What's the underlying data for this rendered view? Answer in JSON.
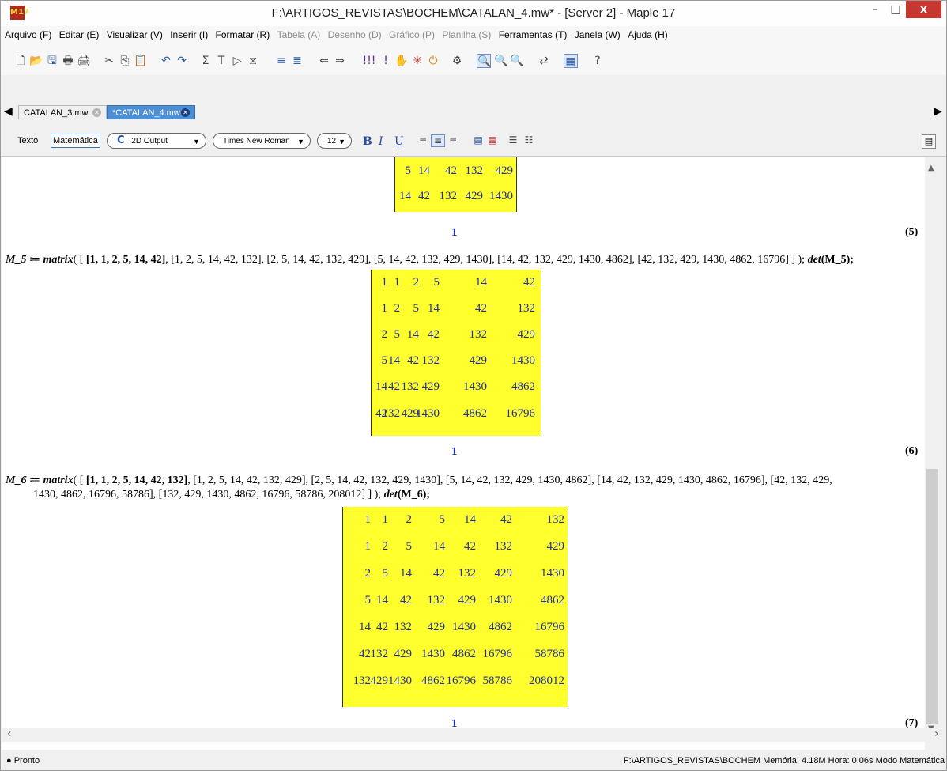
{
  "window": {
    "title": "F:\\ARTIGOS_REVISTAS\\BOCHEM\\CATALAN_4.mw* - [Server 2] - Maple 17",
    "icon_label": "M17",
    "min_glyph": "–",
    "max_glyph": "□",
    "close_glyph": "x"
  },
  "menu": {
    "items": [
      {
        "label": "Arquivo (F)",
        "enabled": true
      },
      {
        "label": "Editar (E)",
        "enabled": true
      },
      {
        "label": "Visualizar (V)",
        "enabled": true
      },
      {
        "label": "Inserir (I)",
        "enabled": true
      },
      {
        "label": "Formatar (R)",
        "enabled": true
      },
      {
        "label": "Tabela (A)",
        "enabled": false
      },
      {
        "label": "Desenho (D)",
        "enabled": false
      },
      {
        "label": "Gráfico (P)",
        "enabled": false
      },
      {
        "label": "Planilha (S)",
        "enabled": false
      },
      {
        "label": "Ferramentas (T)",
        "enabled": true
      },
      {
        "label": "Janela (W)",
        "enabled": true
      },
      {
        "label": "Ajuda (H)",
        "enabled": true
      }
    ]
  },
  "toolbar": {
    "icons": [
      "new-document-icon",
      "open-icon",
      "save-icon",
      "print-icon",
      "print-preview-icon",
      "cut-icon",
      "copy-icon",
      "paste-icon",
      "undo-icon",
      "redo-icon",
      "math-input-icon",
      "text-input-icon",
      "execution-group-icon",
      "section-icon",
      "indent-icon",
      "outdent-icon",
      "back-icon",
      "forward-icon",
      "execute-all-icon",
      "execute-icon",
      "stop-icon",
      "debug-icon",
      "restart-icon",
      "options-icon",
      "zoom-100-icon",
      "zoom-150-icon",
      "zoom-200-icon",
      "toggle-icon",
      "help-palette-icon",
      "help-icon"
    ],
    "glyphs": [
      "🗋",
      "📂",
      "🖫",
      "🖶",
      "🖨",
      "✂",
      "⎘",
      "📋",
      "↶",
      "↷",
      "Σ",
      "T",
      "▷",
      "⧖",
      "≡",
      "≣",
      "⇐",
      "⇒",
      "!!!",
      "!",
      "✋",
      "✳",
      "⏻",
      "⚙",
      "🔍",
      "🔍",
      "🔍",
      "⇄",
      "▦",
      "?"
    ]
  },
  "tabs": [
    {
      "label": "CATALAN_3.mw",
      "active": false
    },
    {
      "label": "*CATALAN_4.mw",
      "active": true
    }
  ],
  "context_bar": {
    "texto_label": "Texto",
    "matematica_label": "Matemática",
    "style_c": "C",
    "style_value": "2D Output",
    "font_value": "Times New Roman",
    "size_value": "12",
    "bold": "B",
    "italic": "I",
    "underline": "U"
  },
  "worksheet": {
    "partial_matrix_rows": [
      [
        "5",
        "14",
        "42",
        "132",
        "429"
      ],
      [
        "14",
        "42",
        "132",
        "429",
        "1430"
      ]
    ],
    "result_5": "1",
    "label_5": "(5)",
    "cmd_m5_prefix": "M_5",
    "cmd_m5_assign": " ≔ ",
    "cmd_m5_func": "matrix",
    "cmd_m5_open": "( [ ",
    "cmd_m5_bold": "[1, 1, 2, 5, 14, 42]",
    "cmd_m5_rest": ", [1, 2, 5, 14, 42, 132], [2, 5, 14, 42, 132, 429], [5, 14, 42, 132, 429, 1430], [14, 42, 132, 429, 1430, 4862], [42, 132, 429, 1430, 4862, 16796] ] ); ",
    "cmd_m5_det": "det",
    "cmd_m5_detarg": "(M_5);",
    "matrix6": [
      [
        "1",
        "1",
        "2",
        "5",
        "14",
        "42"
      ],
      [
        "1",
        "2",
        "5",
        "14",
        "42",
        "132"
      ],
      [
        "2",
        "5",
        "14",
        "42",
        "132",
        "429"
      ],
      [
        "5",
        "14",
        "42",
        "132",
        "429",
        "1430"
      ],
      [
        "14",
        "42",
        "132",
        "429",
        "1430",
        "4862"
      ],
      [
        "42",
        "132",
        "429",
        "1430",
        "4862",
        "16796"
      ]
    ],
    "result_6": "1",
    "label_6": "(6)",
    "cmd_m6_prefix": "M_6",
    "cmd_m6_assign": " ≔ ",
    "cmd_m6_func": "matrix",
    "cmd_m6_open": "( [ ",
    "cmd_m6_bold": "[1, 1, 2, 5, 14, 42, 132]",
    "cmd_m6_rest": ", [1, 2, 5, 14, 42, 132, 429], [2, 5, 14, 42, 132, 429, 1430], [5, 14, 42, 132, 429, 1430, 4862], [14, 42, 132, 429, 1430, 4862, 16796], [42, 132, 429,",
    "cmd_m6_line2": "1430, 4862, 16796, 58786], [132, 429, 1430, 4862, 16796, 58786, 208012] ] ); ",
    "cmd_m6_det": "det",
    "cmd_m6_detarg": "(M_6);",
    "matrix7": [
      [
        "1",
        "1",
        "2",
        "5",
        "14",
        "42",
        "132"
      ],
      [
        "1",
        "2",
        "5",
        "14",
        "42",
        "132",
        "429"
      ],
      [
        "2",
        "5",
        "14",
        "42",
        "132",
        "429",
        "1430"
      ],
      [
        "5",
        "14",
        "42",
        "132",
        "429",
        "1430",
        "4862"
      ],
      [
        "14",
        "42",
        "132",
        "429",
        "1430",
        "4862",
        "16796"
      ],
      [
        "42",
        "132",
        "429",
        "1430",
        "4862",
        "16796",
        "58786"
      ],
      [
        "132",
        "429",
        "1430",
        "4862",
        "16796",
        "58786",
        "208012"
      ]
    ],
    "result_7": "1",
    "label_7": "(7)"
  },
  "status": {
    "left": "● Pronto",
    "right": "F:\\ARTIGOS_REVISTAS\\BOCHEM   Memória: 4.18M   Hora: 0.06s   Modo Matemática"
  },
  "colors": {
    "matrix_bg": "#ffff2e",
    "output_blue": "#1f2fa8",
    "close_red": "#c7372f",
    "active_tab": "#4c8fd7"
  }
}
